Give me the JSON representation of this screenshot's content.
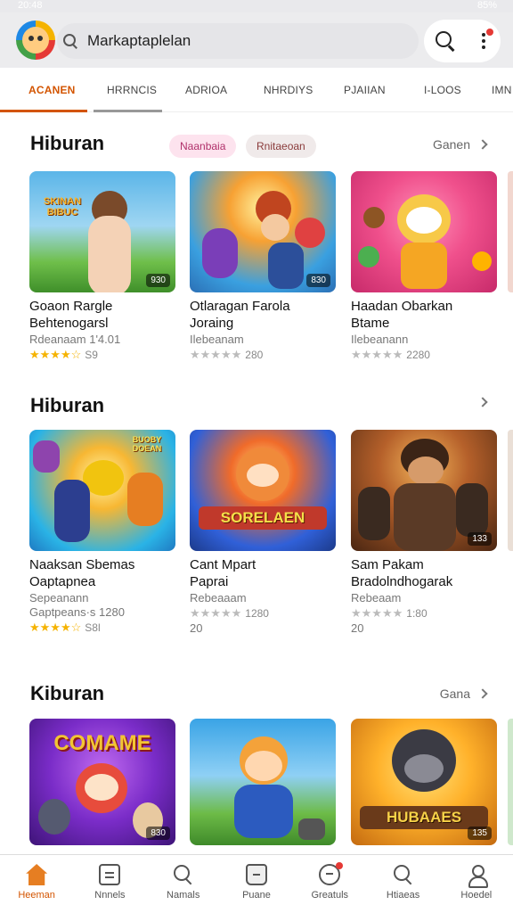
{
  "status": {
    "time": "20:48",
    "battery": "85%"
  },
  "header": {
    "search_text": "Markaptaplelan"
  },
  "tabs": [
    {
      "label": "ACANEN",
      "active": true
    },
    {
      "label": "HRRNCIS"
    },
    {
      "label": "ADRIOA"
    },
    {
      "label": "NHRDIYS"
    },
    {
      "label": "PJAIIAN"
    },
    {
      "label": "I-LOOS"
    },
    {
      "label": "IMN"
    }
  ],
  "sections": [
    {
      "title": "Hiburan",
      "chips": [
        "Naanbaia",
        "Rnitaeoan"
      ],
      "see_all": "Ganen",
      "cards": [
        {
          "title1": "Goaon Rargle",
          "title2": "Behtenogarsl",
          "dev": "Rdeanaam 1'4.01",
          "stars": "★★★★☆",
          "rating_text": "S9",
          "badge": "930",
          "banner": "SKINAN BIBUC",
          "colors": [
            "#5bb5e8",
            "#6fbf4a"
          ]
        },
        {
          "title1": "Otlaragan Farola",
          "title2": "Joraing",
          "dev": "Ilebeanam",
          "stars": "★★★★★",
          "rating_text": "280",
          "badge": "830",
          "banner": "",
          "colors": [
            "#3aa0e0",
            "#f06b2a"
          ]
        },
        {
          "title1": "Haadan Obarkan",
          "title2": "Btame",
          "dev": "Ilebeanann",
          "stars": "★★★★★",
          "rating_text": "2280",
          "badge": "",
          "banner": "",
          "colors": [
            "#f0508c",
            "#f7a133"
          ]
        }
      ]
    },
    {
      "title": "Hiburan",
      "chips": [],
      "see_all": "",
      "cards": [
        {
          "title1": "Naaksan Sbemas",
          "title2": "Oaptapnea",
          "dev": "Sepeanann",
          "extra": "Gaptpeans·s 1280",
          "stars": "★★★★☆",
          "rating_text": "S8l",
          "badge": "",
          "banner": "BUOBY DOEAN",
          "colors": [
            "#2ab3e6",
            "#f7b733"
          ]
        },
        {
          "title1": "Cant Mpart",
          "title2": "Paprai",
          "dev": "Rebeaaam",
          "stars": "★★★★★",
          "rating_text": "1280",
          "extra": "20",
          "badge": "",
          "banner": "SORELAEN",
          "colors": [
            "#3060d8",
            "#f0452e"
          ]
        },
        {
          "title1": "Sam Pakam",
          "title2": "Bradolndhogarak",
          "dev": "Rebeaam",
          "stars": "★★★★★",
          "rating_text": "1:80",
          "extra": "20",
          "badge": "133",
          "banner": "",
          "colors": [
            "#6a3b20",
            "#e8a33c"
          ]
        }
      ]
    },
    {
      "title": "Kiburan",
      "chips": [],
      "see_all": "Gana",
      "cards": [
        {
          "badge": "830",
          "banner": "COMAME",
          "colors": [
            "#7a2cc8",
            "#f2c533"
          ]
        },
        {
          "badge": "",
          "banner": "",
          "colors": [
            "#3aa4e6",
            "#6dbb47"
          ]
        },
        {
          "badge": "135",
          "banner": "HUBAAES",
          "colors": [
            "#ffb12a",
            "#6a3a1a"
          ]
        }
      ]
    }
  ],
  "bottom_nav": [
    {
      "label": "Heeman",
      "icon": "home-icon",
      "active": true
    },
    {
      "label": "Nnnels",
      "icon": "document-icon"
    },
    {
      "label": "Namals",
      "icon": "search-icon"
    },
    {
      "label": "Puane",
      "icon": "bag-icon"
    },
    {
      "label": "Greatuls",
      "icon": "game-icon"
    },
    {
      "label": "Htiaeas",
      "icon": "search-icon"
    },
    {
      "label": "Hoedel",
      "icon": "profile-icon"
    }
  ],
  "colors": {
    "accent": "#d35400",
    "star": "#f5b300",
    "chip_pink": "#fde3ee",
    "chip_gray": "#f0eaea"
  }
}
